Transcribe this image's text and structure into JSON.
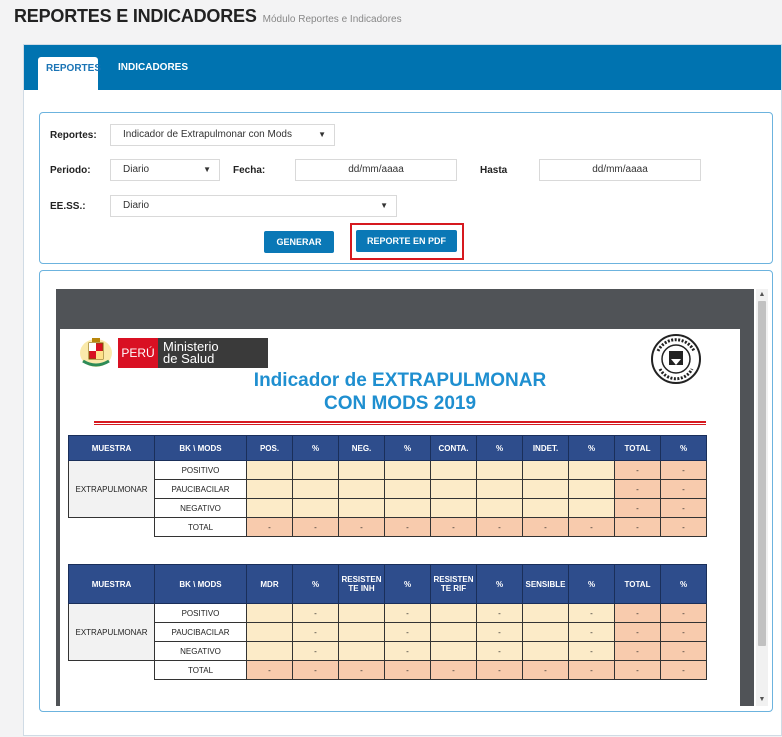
{
  "header": {
    "title": "REPORTES E INDICADORES",
    "subtitle": "Módulo Reportes e Indicadores"
  },
  "tabs": [
    {
      "label": "REPORTES",
      "active": true
    },
    {
      "label": "INDICADORES",
      "active": false
    }
  ],
  "form": {
    "reportes_label": "Reportes:",
    "reportes_value": "Indicador de Extrapulmonar con Mods",
    "periodo_label": "Periodo:",
    "periodo_value": "Diario",
    "fecha_label": "Fecha:",
    "fecha_placeholder": "dd/mm/aaaa",
    "hasta_label": "Hasta",
    "hasta_placeholder": "dd/mm/aaaa",
    "eess_label": "EE.SS.:",
    "eess_value": "Diario",
    "generar_label": "GENERAR",
    "pdf_label": "REPORTE EN PDF"
  },
  "document": {
    "peru": "PERÚ",
    "ministerio": "Ministerio",
    "de_salud": "de Salud",
    "title_line1": "Indicador de EXTRAPULMONAR",
    "title_line2": "CON MODS 2019",
    "table1_headers": [
      "MUESTRA",
      "BK \\ MODS",
      "POS.",
      "%",
      "NEG.",
      "%",
      "CONTA.",
      "%",
      "INDET.",
      "%",
      "TOTAL",
      "%"
    ],
    "table2_headers": [
      "MUESTRA",
      "BK \\ MODS",
      "MDR",
      "%",
      "RESISTEN TE INH",
      "%",
      "RESISTEN TE RIF",
      "%",
      "SENSIBLE",
      "%",
      "TOTAL",
      "%"
    ],
    "muestra": "EXTRAPULMONAR",
    "rows": [
      "POSITIVO",
      "PAUCIBACILAR",
      "NEGATIVO",
      "TOTAL"
    ],
    "dash": "-"
  },
  "colors": {
    "primary": "#0073b0",
    "header_blue": "#2e4d8c",
    "cell_yellow": "#fcebc8",
    "cell_orange": "#f8cbad",
    "highlight_red": "#d6191f"
  }
}
